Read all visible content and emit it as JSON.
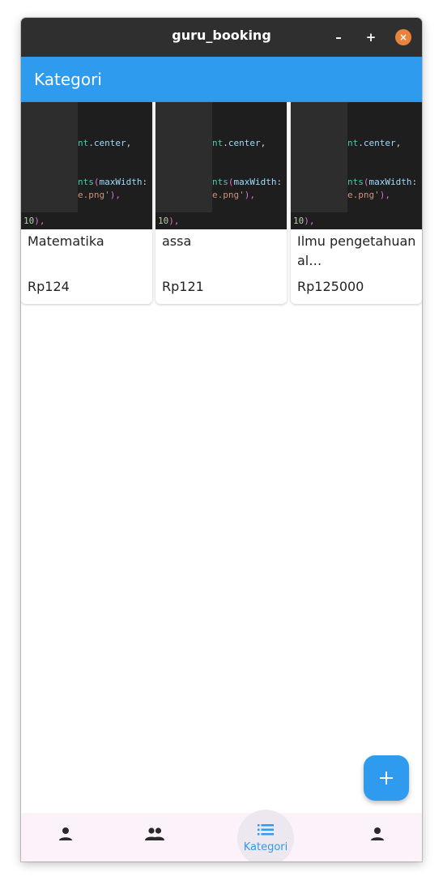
{
  "window": {
    "title": "guru_booking",
    "controls": {
      "minimize": "–",
      "maximize": "+",
      "close": "×"
    }
  },
  "appbar": {
    "title": "Kategori"
  },
  "categories": [
    {
      "name": "Matematika",
      "price": "Rp124"
    },
    {
      "name": "assa",
      "price": "Rp121"
    },
    {
      "name": "Ilmu pengetahuan al…",
      "price": "Rp125000"
    }
  ],
  "thumbnail_code": {
    "line1a": "nt",
    "line1b": ".",
    "line1c": "center",
    "line1d": ",",
    "line2a": "nts",
    "line2b": "(",
    "line2c": "maxWidth",
    "line2d": ":",
    "line3a": "e.png'",
    "line3b": "),",
    "line4a": "10",
    "line4b": "),"
  },
  "fab": {
    "icon": "plus-icon"
  },
  "bottom_nav": {
    "items": [
      {
        "icon": "person-icon",
        "label": ""
      },
      {
        "icon": "people-icon",
        "label": ""
      },
      {
        "icon": "list-icon",
        "label": "Kategori"
      },
      {
        "icon": "person-icon",
        "label": ""
      }
    ],
    "active_index": 2
  },
  "colors": {
    "primary": "#2f9bef",
    "titlebar": "#2f2f2f",
    "close_button": "#e9823a",
    "nav_background": "#fcf3fa"
  }
}
